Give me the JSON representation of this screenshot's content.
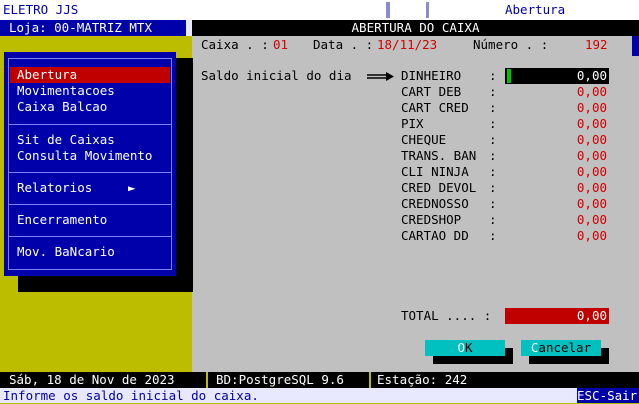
{
  "topbar": {
    "app_name": "ELETRO JJS",
    "right_label": "Abertura"
  },
  "loja": "Loja: 00-MATRIZ MTX",
  "dialog": {
    "title": "ABERTURA DO CAIXA",
    "caixa_label": "Caixa . :",
    "caixa_value": "01",
    "data_label": "Data . :",
    "data_value": "18/11/23",
    "numero_label": "Número . :",
    "numero_value": "192",
    "saldo_label": "Saldo inicial do dia",
    "rows": [
      {
        "label": "DINHEIRO",
        "value": "0,00"
      },
      {
        "label": "CART DEB",
        "value": "0,00"
      },
      {
        "label": "CART CRED",
        "value": "0,00"
      },
      {
        "label": "PIX",
        "value": "0,00"
      },
      {
        "label": "CHEQUE",
        "value": "0,00"
      },
      {
        "label": "TRANS. BAN",
        "value": "0,00"
      },
      {
        "label": "CLI NINJA",
        "value": "0,00"
      },
      {
        "label": "CRED DEVOL",
        "value": "0,00"
      },
      {
        "label": "CREDNOSSO",
        "value": "0,00"
      },
      {
        "label": "CREDSHOP",
        "value": "0,00"
      },
      {
        "label": "CARTAO DD",
        "value": "0,00"
      }
    ],
    "total_label": "TOTAL .... :",
    "total_value": "0,00",
    "ok_hotkey": "O",
    "ok_rest": "K",
    "cancel_hotkey": "C",
    "cancel_rest": "ancelar"
  },
  "menu": {
    "items": [
      {
        "label": "Abertura"
      },
      {
        "label": "Movimentacoes"
      },
      {
        "label": "Caixa Balcao"
      },
      {
        "label": "Sit de Caixas"
      },
      {
        "label": "Consulta Movimento"
      },
      {
        "label": "Relatorios"
      },
      {
        "label": "Encerramento"
      },
      {
        "label": "Mov. BaNcario"
      }
    ],
    "submenu_arrow": "►"
  },
  "status": {
    "date": "Sáb, 18 de Nov de 2023",
    "db": "BD:PostgreSQL 9.6",
    "station": "Estação: 242"
  },
  "help": {
    "message": "Informe os saldo inicial do caixa.",
    "esc": "ESC-Sair"
  },
  "colors": {
    "background": "#bcbc00",
    "menu_bg": "#0000aa",
    "selected": "#c00000",
    "dialog_bg": "#c0c0c0",
    "button": "#00c0c0"
  }
}
